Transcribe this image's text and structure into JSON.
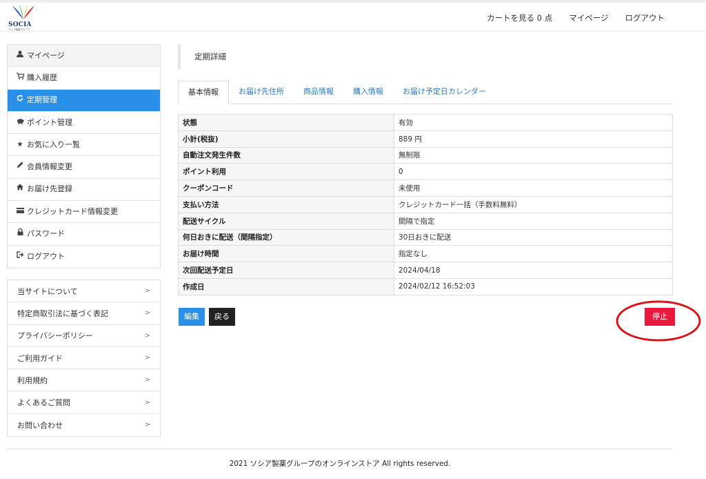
{
  "header": {
    "logo_text": "SOCIA",
    "logo_sub": "ソシア製薬グループ",
    "nav": {
      "cart": "カートを見る 0 点",
      "mypage": "マイページ",
      "logout": "ログアウト"
    }
  },
  "sidebar": {
    "items": [
      {
        "label": "マイページ",
        "icon": "user-icon"
      },
      {
        "label": "購入履歴",
        "icon": "cart-icon"
      },
      {
        "label": "定期管理",
        "icon": "refresh-icon"
      },
      {
        "label": "ポイント管理",
        "icon": "piggy-bank-icon"
      },
      {
        "label": "お気に入り一覧",
        "icon": "star-icon"
      },
      {
        "label": "会員情報変更",
        "icon": "pencil-icon"
      },
      {
        "label": "お届け先登録",
        "icon": "home-icon"
      },
      {
        "label": "クレジットカード情報変更",
        "icon": "credit-card-icon"
      },
      {
        "label": "パスワード",
        "icon": "lock-icon"
      },
      {
        "label": "ログアウト",
        "icon": "logout-icon"
      }
    ],
    "active_index": 2,
    "links": [
      {
        "label": "当サイトについて",
        "arrow": ">"
      },
      {
        "label": "特定商取引法に基づく表記",
        "arrow": ">"
      },
      {
        "label": "プライバシーポリシー",
        "arrow": ">"
      },
      {
        "label": "ご利用ガイド",
        "arrow": ">"
      },
      {
        "label": "利用規約",
        "arrow": ">"
      },
      {
        "label": "よくあるご質問",
        "arrow": ">"
      },
      {
        "label": "お問い合わせ",
        "arrow": ">"
      }
    ]
  },
  "main": {
    "title": "定期詳細",
    "tabs": [
      {
        "label": "基本情報",
        "active": true
      },
      {
        "label": "お届け先住所",
        "active": false
      },
      {
        "label": "商品情報",
        "active": false
      },
      {
        "label": "購入情報",
        "active": false
      },
      {
        "label": "お届け予定日カレンダー",
        "active": false
      }
    ],
    "details": [
      {
        "label": "状態",
        "value": "有効"
      },
      {
        "label": "小計(税抜)",
        "value": "889 円"
      },
      {
        "label": "自動注文発生件数",
        "value": "無制限"
      },
      {
        "label": "ポイント利用",
        "value": "0"
      },
      {
        "label": "クーポンコード",
        "value": "未使用"
      },
      {
        "label": "支払い方法",
        "value": "クレジットカード一括（手数料無料）"
      },
      {
        "label": "配送サイクル",
        "value": "間隔で指定"
      },
      {
        "label": "何日おきに配送（間隔指定）",
        "value": "30日おきに配送"
      },
      {
        "label": "お届け時間",
        "value": "指定なし"
      },
      {
        "label": "次回配送予定日",
        "value": "2024/04/18"
      },
      {
        "label": "作成日",
        "value": "2024/02/12 16:52:03"
      }
    ],
    "buttons": {
      "edit": "編集",
      "back": "戻る",
      "stop": "停止"
    }
  },
  "footer": {
    "text": "2021 ソシア製薬グループのオンラインストア All rights reserved."
  },
  "colors": {
    "accent_blue": "#2a8fe6",
    "stop_red": "#e8193c",
    "annotation_red": "#d8141c",
    "back_dark": "#222222"
  }
}
